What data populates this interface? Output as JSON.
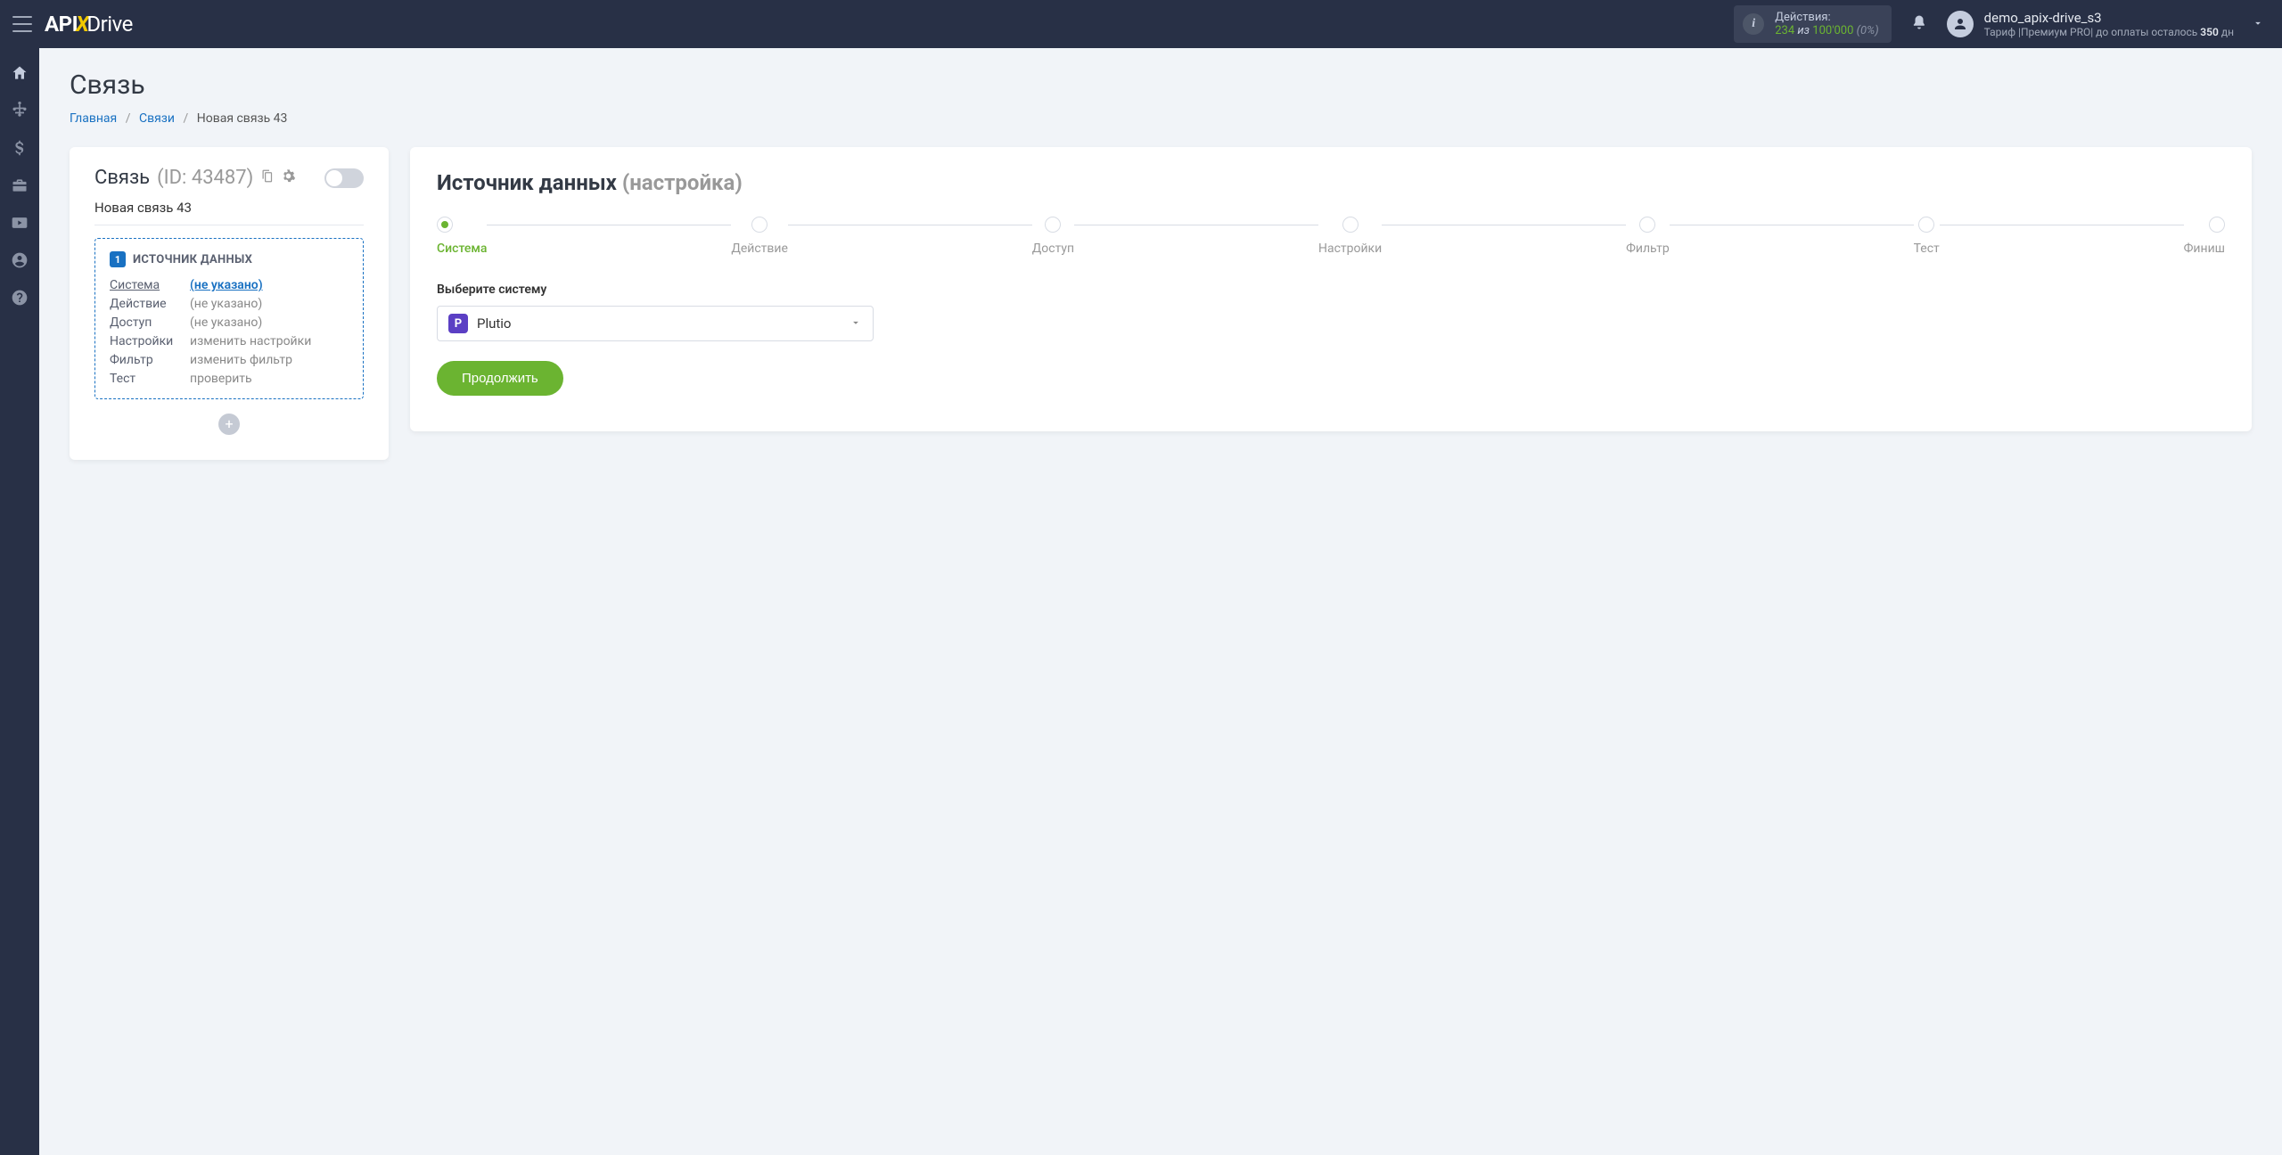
{
  "header": {
    "logo": {
      "p1": "API",
      "p2": "X",
      "p3": "Drive"
    },
    "actions": {
      "label": "Действия:",
      "used": "234",
      "iz": "из",
      "total": "100'000",
      "pct": "(0%)"
    },
    "user": {
      "name": "demo_apix-drive_s3",
      "tariff_prefix": "Тариф |Премиум PRO|  до оплаты осталось ",
      "days_num": "350",
      "days_unit": " дн"
    }
  },
  "page": {
    "title": "Связь",
    "breadcrumbs": {
      "home": "Главная",
      "links": "Связи",
      "current": "Новая связь 43"
    }
  },
  "left_card": {
    "title": "Связь",
    "id_label": "(ID: 43487)",
    "subtitle": "Новая связь 43",
    "source_box": {
      "badge": "1",
      "title": "ИСТОЧНИК ДАННЫХ",
      "rows": [
        {
          "label": "Система",
          "value": "(не указано)",
          "active": true
        },
        {
          "label": "Действие",
          "value": "(не указано)",
          "active": false
        },
        {
          "label": "Доступ",
          "value": "(не указано)",
          "active": false
        },
        {
          "label": "Настройки",
          "value": "изменить настройки",
          "active": false
        },
        {
          "label": "Фильтр",
          "value": "изменить фильтр",
          "active": false
        },
        {
          "label": "Тест",
          "value": "проверить",
          "active": false
        }
      ]
    }
  },
  "right_card": {
    "title": "Источник данных",
    "title_gray": "(настройка)",
    "steps": [
      "Система",
      "Действие",
      "Доступ",
      "Настройки",
      "Фильтр",
      "Тест",
      "Финиш"
    ],
    "field_label": "Выберите систему",
    "select": {
      "icon": "P",
      "text": "Plutio"
    },
    "continue": "Продолжить"
  }
}
